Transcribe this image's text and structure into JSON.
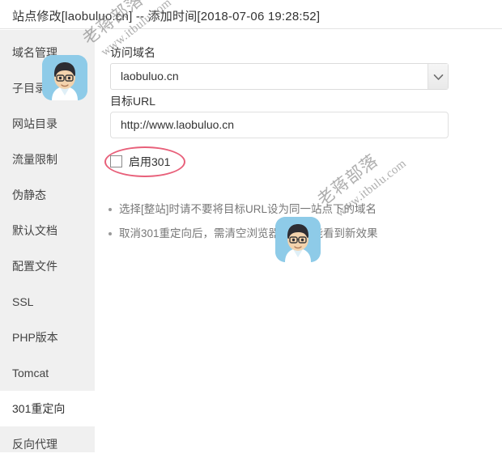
{
  "header": {
    "title": "站点修改[laobuluo.cn] -- 添加时间[2018-07-06 19:28:52]"
  },
  "sidebar": {
    "items": [
      {
        "label": "域名管理",
        "active": false
      },
      {
        "label": "子目录",
        "active": false
      },
      {
        "label": "网站目录",
        "active": false
      },
      {
        "label": "流量限制",
        "active": false
      },
      {
        "label": "伪静态",
        "active": false
      },
      {
        "label": "默认文档",
        "active": false
      },
      {
        "label": "配置文件",
        "active": false
      },
      {
        "label": "SSL",
        "active": false
      },
      {
        "label": "PHP版本",
        "active": false
      },
      {
        "label": "Tomcat",
        "active": false
      },
      {
        "label": "301重定向",
        "active": true
      },
      {
        "label": "反向代理",
        "active": false
      }
    ]
  },
  "form": {
    "domain_label": "访问域名",
    "domain_value": "laobuluo.cn",
    "domain_options": [
      "laobuluo.cn"
    ],
    "url_label": "目标URL",
    "url_value": "http://www.laobuluo.cn",
    "url_placeholder": "http://www.laobuluo.cn",
    "enable301_label": "启用301",
    "enable301_checked": false
  },
  "notes": [
    "选择[整站]时请不要将目标URL设为同一站点下的域名",
    "取消301重定向后，需清空浏览器缓存才能看到新效果"
  ],
  "watermark": {
    "brand": "老蒋部落",
    "url": "www.itbulu.com"
  },
  "colors": {
    "annotation": "#e8607a",
    "sidebar_bg": "#f0f0f0",
    "text": "#333333",
    "note_text": "#777777"
  }
}
